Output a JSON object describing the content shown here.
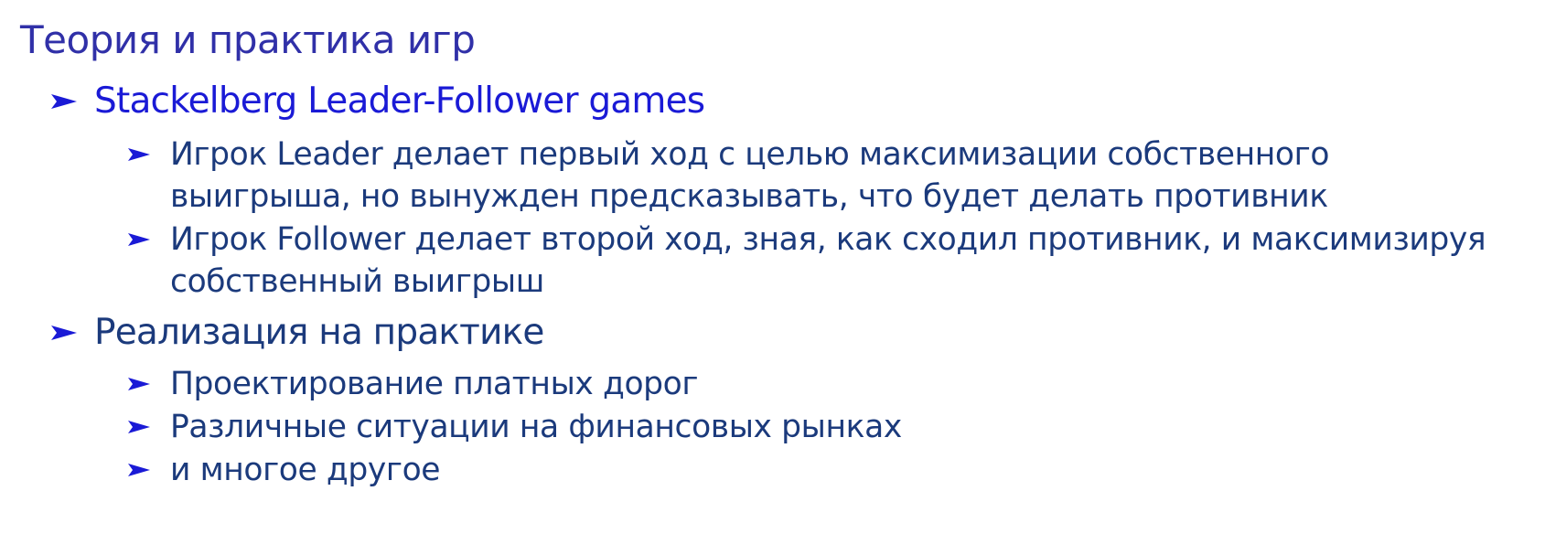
{
  "title": "Теория и практика игр",
  "colors": {
    "title": "#3030a8",
    "bullet1": "#1a1ad6",
    "bullet2": "#1b3a7c",
    "arrow": "#1a1ad6"
  },
  "bullets": [
    {
      "text": "Stackelberg Leader-Follower games",
      "subitems": [
        {
          "lines": [
            "Игрок Leader делает первый ход с целью максимизации собственного",
            "выигрыша, но вынужден предсказывать, что будет делать противник"
          ]
        },
        {
          "lines": [
            "Игрок Follower делает второй ход, зная, как сходил противник, и максимизируя",
            "собственный выигрыш"
          ]
        }
      ]
    },
    {
      "text": "Реализация на практике",
      "subitems": [
        {
          "lines": [
            "Проектирование платных дорог"
          ]
        },
        {
          "lines": [
            "Различные ситуации на финансовых рынках"
          ]
        },
        {
          "lines": [
            "и многое другое"
          ]
        }
      ]
    }
  ]
}
